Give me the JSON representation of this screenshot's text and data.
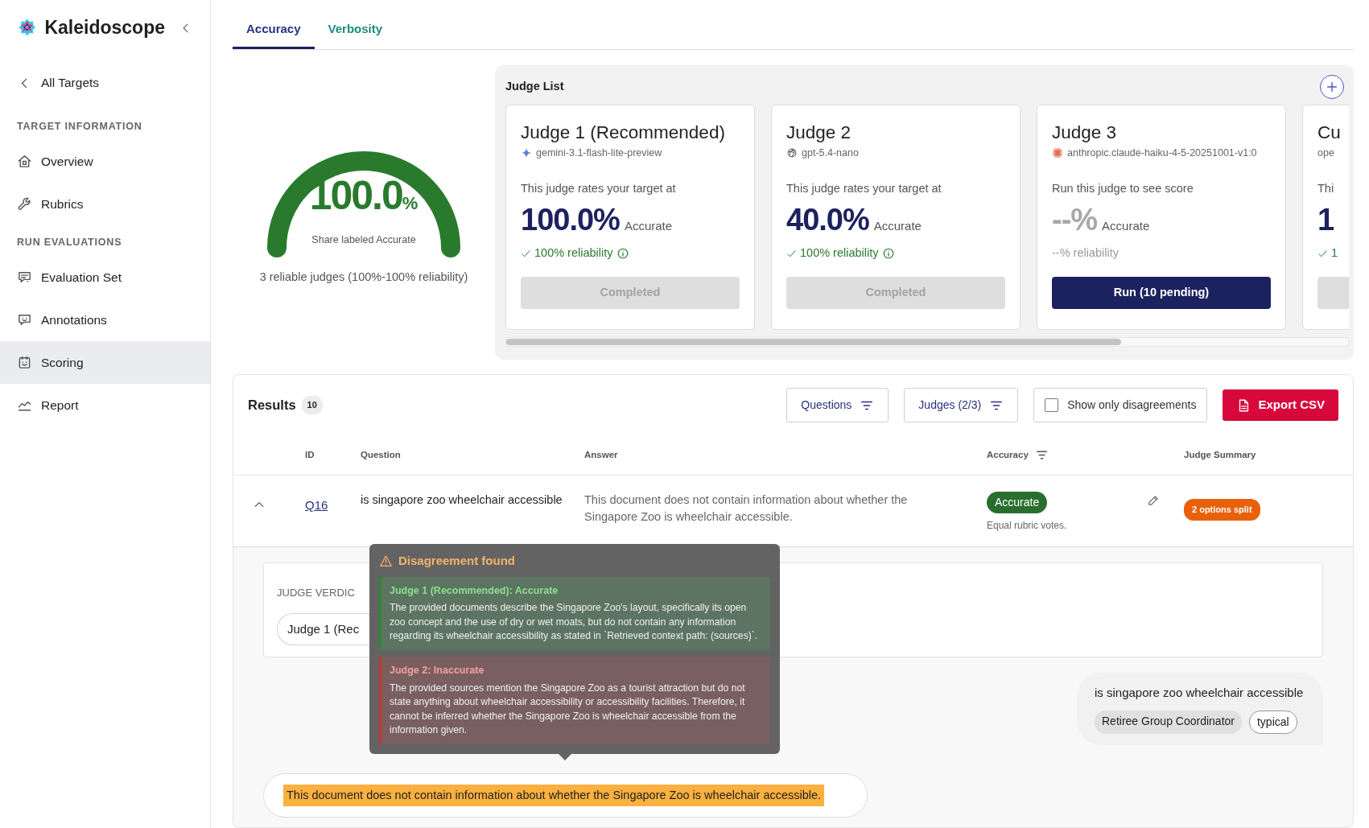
{
  "sidebar": {
    "brand": "Kaleidoscope",
    "back_link": "All Targets",
    "sections": [
      {
        "heading": "TARGET INFORMATION",
        "items": [
          {
            "label": "Overview",
            "selected": false
          },
          {
            "label": "Rubrics",
            "selected": false
          }
        ]
      },
      {
        "heading": "RUN EVALUATIONS",
        "items": [
          {
            "label": "Evaluation Set",
            "selected": false
          },
          {
            "label": "Annotations",
            "selected": false
          },
          {
            "label": "Scoring",
            "selected": true
          },
          {
            "label": "Report",
            "selected": false
          }
        ]
      }
    ]
  },
  "tabs": [
    {
      "label": "Accuracy",
      "selected": true
    },
    {
      "label": "Verbosity",
      "selected": false
    }
  ],
  "gauge": {
    "value": "100.0",
    "unit": "%",
    "caption": "Share labeled Accurate",
    "summary": "3 reliable judges (100%-100% reliability)"
  },
  "judge_list": {
    "title": "Judge List",
    "judges": [
      {
        "title": "Judge 1 (Recommended)",
        "model": "gemini-3.1-flash-lite-preview",
        "caption": "This judge rates your target at",
        "score": "100.0%",
        "score_label": "Accurate",
        "reliability": "100% reliability",
        "reliable": true,
        "completed": true,
        "button": "Completed"
      },
      {
        "title": "Judge 2",
        "model": "gpt-5.4-nano",
        "caption": "This judge rates your target at",
        "score": "40.0%",
        "score_label": "Accurate",
        "reliability": "100% reliability",
        "reliable": true,
        "completed": true,
        "button": "Completed"
      },
      {
        "title": "Judge 3",
        "model": "anthropic.claude-haiku-4-5-20251001-v1:0",
        "caption": "Run this judge to see score",
        "score": "--%",
        "score_label": "Accurate",
        "reliability": "--% reliability",
        "reliable": false,
        "completed": false,
        "button": "Run (10 pending)"
      },
      {
        "title": "Cu",
        "model": "ope",
        "caption": "Thi",
        "score": "1",
        "reliability": "1",
        "reliable": true,
        "completed": true
      }
    ]
  },
  "results": {
    "title": "Results",
    "count": "10",
    "filters": [
      {
        "label": "Questions"
      },
      {
        "label": "Judges (2/3)"
      }
    ],
    "disagreements_toggle": {
      "label": "Show only disagreements",
      "checked": false
    },
    "export_label": "Export CSV",
    "columns": [
      {
        "label": "ID",
        "filterable": false
      },
      {
        "label": "Question",
        "filterable": false
      },
      {
        "label": "Answer",
        "filterable": false
      },
      {
        "label": "Accuracy",
        "filterable": true
      },
      {
        "label": "Judge Summary",
        "filterable": false
      }
    ],
    "rows": [
      {
        "id": "Q16",
        "question": "is singapore zoo wheelchair accessible",
        "answer": "This document does not contain information about whether the Singapore Zoo is wheelchair accessible.",
        "accuracy": "Accurate",
        "accurate": true,
        "accuracy_note": "Equal rubric votes.",
        "summary": "2 options split",
        "expanded": true,
        "detail": {
          "verdicts_label": "JUDGE VERDIC",
          "verdict_chips": [
            "Judge 1 (Rec"
          ],
          "question": "is singapore zoo wheelchair accessible",
          "tags": [
            {
              "label": "Retiree Group Coordinator",
              "kind": "filled"
            },
            {
              "label": "typical",
              "kind": "outline"
            }
          ],
          "answer": "This document does not contain information about whether the Singapore Zoo is wheelchair accessible.",
          "answer_highlighted": true,
          "disagreement": {
            "title": "Disagreement found",
            "opinions": [
              {
                "heading": "Judge 1 (Recommended): Accurate",
                "accurate": true,
                "text": "The provided documents describe the Singapore Zoo's layout, specifically its open zoo concept and the use of dry or wet moats, but do not contain any information regarding its wheelchair accessibility as stated in `Retrieved context path: (sources)`."
              },
              {
                "heading": "Judge 2: Inaccurate",
                "accurate": false,
                "text": "The provided sources mention the Singapore Zoo as a tourist attraction but do not state anything about wheelchair accessibility or accessibility facilities. Therefore, it cannot be inferred whether the Singapore Zoo is wheelchair accessible from the information given."
              }
            ]
          }
        }
      }
    ]
  }
}
